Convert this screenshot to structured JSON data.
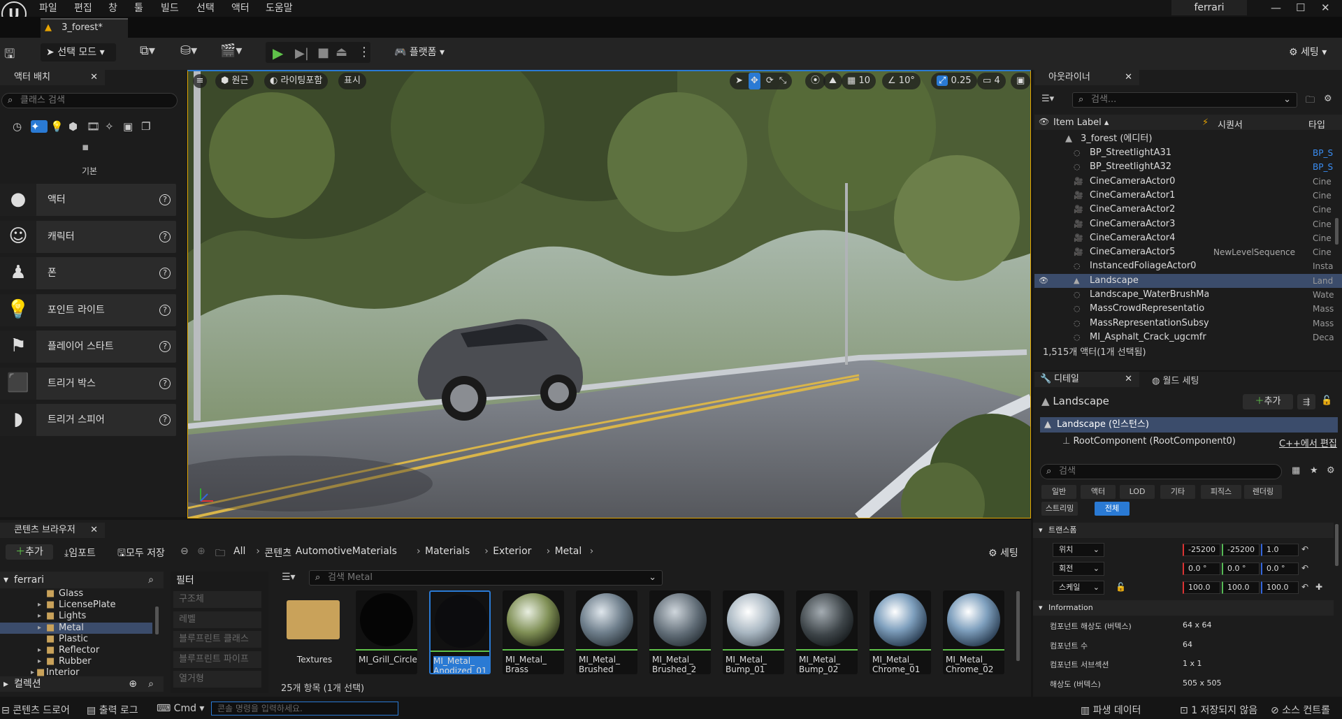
{
  "menu": [
    "파일",
    "편집",
    "창",
    "툴",
    "빌드",
    "선택",
    "액터",
    "도움말"
  ],
  "project_name": "ferrari",
  "level_tab": "3_forest*",
  "toolbar": {
    "select_mode": "선택 모드",
    "platform": "플랫폼",
    "settings": "세팅"
  },
  "place_actors": {
    "tab": "액터 배치",
    "search_placeholder": "클래스 검색",
    "category": "기본",
    "items": [
      "액터",
      "캐릭터",
      "폰",
      "포인트 라이트",
      "플레이어 스타트",
      "트리거 박스",
      "트리거 스피어"
    ]
  },
  "viewport": {
    "perspective": "원근",
    "lighting": "라이팅포함",
    "show": "표시",
    "grid_snap": "10",
    "rot_snap": "10°",
    "scale_snap": "0.25",
    "camera_speed": "4"
  },
  "outliner": {
    "tab": "아웃라이너",
    "search_placeholder": "검색...",
    "col_label": "Item Label",
    "col_sequencer": "시퀀서",
    "col_type": "타입",
    "root": "3_forest (에디터)",
    "rows": [
      {
        "name": "BP_StreetlightA31",
        "seq": "",
        "type": "BP_S",
        "icon": "actor-icon"
      },
      {
        "name": "BP_StreetlightA32",
        "seq": "",
        "type": "BP_S",
        "icon": "actor-icon"
      },
      {
        "name": "CineCameraActor0",
        "seq": "",
        "type": "Cine",
        "icon": "camera-icon"
      },
      {
        "name": "CineCameraActor1",
        "seq": "",
        "type": "Cine",
        "icon": "camera-icon"
      },
      {
        "name": "CineCameraActor2",
        "seq": "",
        "type": "Cine",
        "icon": "camera-icon"
      },
      {
        "name": "CineCameraActor3",
        "seq": "",
        "type": "Cine",
        "icon": "camera-icon"
      },
      {
        "name": "CineCameraActor4",
        "seq": "",
        "type": "Cine",
        "icon": "camera-icon"
      },
      {
        "name": "CineCameraActor5",
        "seq": "NewLevelSequence",
        "type": "Cine",
        "icon": "camera-icon"
      },
      {
        "name": "InstancedFoliageActor0",
        "seq": "",
        "type": "Insta",
        "icon": "actor-icon"
      },
      {
        "name": "Landscape",
        "seq": "",
        "type": "Land",
        "icon": "landscape-icon"
      },
      {
        "name": "Landscape_WaterBrushMa",
        "seq": "",
        "type": "Wate",
        "icon": "actor-icon"
      },
      {
        "name": "MassCrowdRepresentatio",
        "seq": "",
        "type": "Mass",
        "icon": "actor-icon"
      },
      {
        "name": "MassRepresentationSubsy",
        "seq": "",
        "type": "Mass",
        "icon": "actor-icon"
      },
      {
        "name": "MI_Asphalt_Crack_ugcmfr",
        "seq": "",
        "type": "Deca",
        "icon": "actor-icon"
      }
    ],
    "count": "1,515개 액터(1개 선택됨)"
  },
  "details": {
    "tab": "디테일",
    "world_tab": "월드 세팅",
    "actor_name": "Landscape",
    "add_button": "추가",
    "instance": "Landscape (인스턴스)",
    "root_component": "RootComponent (RootComponent0)",
    "edit_cpp": "C++에서 편집",
    "search_placeholder": "검색",
    "categories": [
      "일반",
      "액터",
      "LOD",
      "기타",
      "피직스",
      "렌더링",
      "스트리밍",
      "전체"
    ],
    "transform_header": "트랜스폼",
    "location_label": "위치",
    "location": [
      "-25200",
      "-25200",
      "1.0"
    ],
    "rotation_label": "회전",
    "rotation": [
      "0.0 °",
      "0.0 °",
      "0.0 °"
    ],
    "scale_label": "스케일",
    "scale": [
      "100.0",
      "100.0",
      "100.0"
    ],
    "info_header": "Information",
    "info": [
      {
        "label": "컴포넌트 해상도 (버텍스)",
        "value": "64 x 64"
      },
      {
        "label": "컴포넌트 수",
        "value": "64"
      },
      {
        "label": "컴포넌트 서브섹션",
        "value": "1 x 1"
      },
      {
        "label": "해상도 (버텍스)",
        "value": "505 x 505"
      }
    ]
  },
  "content_browser": {
    "tab": "콘텐츠 브라우저",
    "add": "추가",
    "import": "임포트",
    "save_all": "모두 저장",
    "settings": "세팅",
    "breadcrumb": [
      "All",
      "콘텐츠",
      "AutomotiveMaterials",
      "Materials",
      "Exterior",
      "Metal"
    ],
    "tree_root": "ferrari",
    "tree": [
      "Glass",
      "LicensePlate",
      "Lights",
      "Metal",
      "Plastic",
      "Reflector",
      "Rubber",
      "Interior"
    ],
    "collections": "컬렉션",
    "filter_header": "필터",
    "filters": [
      "구조체",
      "레벨",
      "블루프린트 클래스",
      "블루프린트 파이프",
      "열거형"
    ],
    "search_placeholder": "검색 Metal",
    "assets": [
      {
        "n1": "Textures",
        "n2": ""
      },
      {
        "n1": "MI_Grill_Circle",
        "n2": ""
      },
      {
        "n1": "MI_Metal_",
        "n2": "Anodized_01"
      },
      {
        "n1": "MI_Metal_",
        "n2": "Brass"
      },
      {
        "n1": "MI_Metal_",
        "n2": "Brushed"
      },
      {
        "n1": "MI_Metal_",
        "n2": "Brushed_2"
      },
      {
        "n1": "MI_Metal_",
        "n2": "Bump_01"
      },
      {
        "n1": "MI_Metal_",
        "n2": "Bump_02"
      },
      {
        "n1": "MI_Metal_",
        "n2": "Chrome_01"
      },
      {
        "n1": "MI_Metal_",
        "n2": "Chrome_02"
      }
    ],
    "count": "25개 항목 (1개 선택)"
  },
  "statusbar": {
    "content_drawer": "콘텐츠 드로어",
    "output_log": "출력 로그",
    "cmd": "Cmd",
    "console_placeholder": "콘솔 명령을 입력하세요.",
    "derived_data": "파생 데이터",
    "unsaved": "1 저장되지 않음",
    "source_control": "소스 컨트롤"
  }
}
